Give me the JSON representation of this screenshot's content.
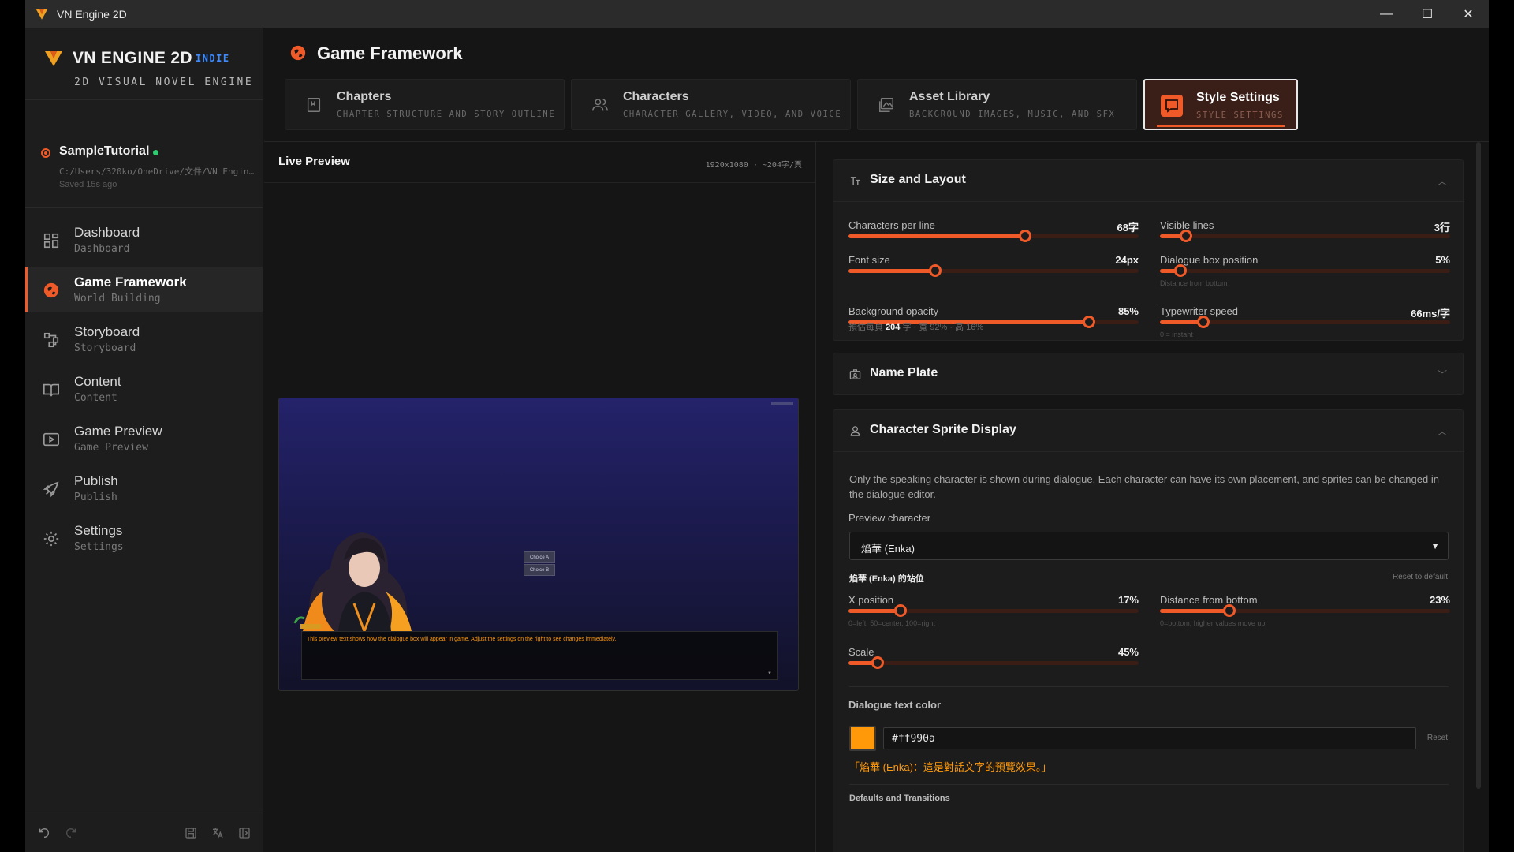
{
  "window": {
    "title": "VN Engine 2D",
    "controls": [
      "—",
      "☐",
      "✕"
    ]
  },
  "brand": {
    "name": "VN ENGINE 2D",
    "badge": "INDIE",
    "subtitle": "2D VISUAL NOVEL ENGINE"
  },
  "project": {
    "name": "SampleTutorial",
    "path": "C:/Users/320ko/OneDrive/文件/VN Engin…",
    "saved": "Saved 15s ago"
  },
  "nav": [
    {
      "label": "Dashboard",
      "sub": "Dashboard",
      "icon": "dashboard-icon"
    },
    {
      "label": "Game Framework",
      "sub": "World Building",
      "icon": "globe-icon",
      "active": true
    },
    {
      "label": "Storyboard",
      "sub": "Storyboard",
      "icon": "storyboard-icon"
    },
    {
      "label": "Content",
      "sub": "Content",
      "icon": "book-icon"
    },
    {
      "label": "Game Preview",
      "sub": "Game Preview",
      "icon": "play-icon"
    },
    {
      "label": "Publish",
      "sub": "Publish",
      "icon": "rocket-icon"
    },
    {
      "label": "Settings",
      "sub": "Settings",
      "icon": "gear-icon"
    }
  ],
  "page": {
    "title": "Game Framework"
  },
  "tabs": [
    {
      "label": "Chapters",
      "sub": "CHAPTER STRUCTURE AND STORY OUTLINE"
    },
    {
      "label": "Characters",
      "sub": "CHARACTER GALLERY, VIDEO, AND VOICE"
    },
    {
      "label": "Asset Library",
      "sub": "BACKGROUND IMAGES, MUSIC, AND SFX"
    },
    {
      "label": "Style Settings",
      "sub": "STYLE SETTINGS",
      "active": true
    }
  ],
  "preview": {
    "title": "Live Preview",
    "meta": "1920x1080 · ~204字/頁",
    "choices": [
      "Choice A",
      "Choice B"
    ],
    "dialogue_text": "This preview text shows how the dialogue box will appear in game. Adjust the settings on the right to see changes immediately.",
    "continue_arrow": "▼"
  },
  "size_layout": {
    "title": "Size and Layout",
    "sliders": {
      "chars_per_line": {
        "label": "Characters per line",
        "value": "68字",
        "fraction": 0.61
      },
      "visible_lines": {
        "label": "Visible lines",
        "value": "3行",
        "fraction": 0.09
      },
      "font_size": {
        "label": "Font size",
        "value": "24px",
        "fraction": 0.3
      },
      "dialogue_pos": {
        "label": "Dialogue box position",
        "value": "5%",
        "fraction": 0.07,
        "hint": "Distance from bottom"
      },
      "bg_opacity": {
        "label": "Background opacity",
        "value": "85%",
        "fraction": 0.83
      },
      "typewriter": {
        "label": "Typewriter speed",
        "value": "66ms/字",
        "fraction": 0.15,
        "hint": "0 = instant"
      }
    },
    "summary_prefix": "預估每頁",
    "summary_count": "204",
    "summary_suffix": "字 · 寬 92% · 高 16%"
  },
  "name_plate": {
    "title": "Name Plate"
  },
  "sprite": {
    "title": "Character Sprite Display",
    "description": "Only the speaking character is shown during dialogue. Each character can have its own placement, and sprites can be changed in the dialogue editor.",
    "preview_label": "Preview character",
    "preview_value": "焰華 (Enka)",
    "position_title": "焰華 (Enka) 的站位",
    "reset_default": "Reset to default",
    "sliders": {
      "x_pos": {
        "label": "X position",
        "value": "17%",
        "fraction": 0.18,
        "hint": "0=left, 50=center, 100=right"
      },
      "dist_bottom": {
        "label": "Distance from bottom",
        "value": "23%",
        "fraction": 0.24,
        "hint": "0=bottom, higher values move up"
      },
      "scale": {
        "label": "Scale",
        "value": "45%",
        "fraction": 0.1
      }
    },
    "text_color_label": "Dialogue text color",
    "text_color": "#ff990a",
    "text_color_value": "#ff990a",
    "reset": "Reset",
    "color_preview": "「焰華 (Enka)：這是對話文字的預覽效果。」",
    "next_section": "Defaults and Transitions"
  },
  "colors": {
    "accent": "#f05a28",
    "badge": "#3d8bff",
    "online": "#2ecc71"
  }
}
